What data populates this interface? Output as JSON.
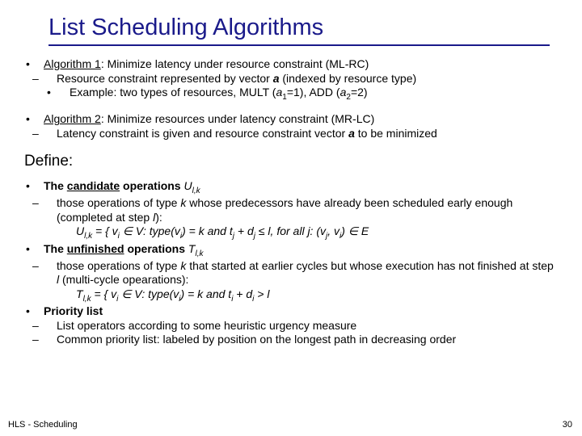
{
  "title": "List Scheduling Algorithms",
  "algo1": {
    "label": "Algorithm 1",
    "desc": ": Minimize latency under resource constraint  (ML-RC)",
    "sub1a": "Resource constraint represented by vector ",
    "sub1b": " (indexed by resource type)",
    "ex_a": "Example: two types of resources, MULT (",
    "ex_b": "=1), ADD (",
    "ex_c": "=2)"
  },
  "algo2": {
    "label": "Algorithm 2",
    "desc": ": Minimize resources under latency constraint  (MR-LC)",
    "sub1a": "Latency constraint is given and resource constraint vector ",
    "sub1b": " to be minimized"
  },
  "define": "Define:",
  "cand": {
    "a": "The ",
    "b": "candidate",
    "c": " operations ",
    "sym": "U",
    "sub": "l,k",
    "s1": "those operations of type ",
    "s1k": "k",
    "s1b": " whose predecessors have already been scheduled early enough (completed at step ",
    "s1l": "l",
    "s1c": "):",
    "f_pre": "U",
    "f1": " = { v",
    "f2": " ∈ V: type(v",
    "f3": ") = k   and   t",
    "f4": " + d",
    "f5": " ≤ l, for all j: (v",
    "f6": ", v",
    "f7": ") ∈ E"
  },
  "unf": {
    "a": "The ",
    "b": "unfinished",
    "c": " operations ",
    "sym": "T",
    "sub": "l,k",
    "s1a": "those operations of type ",
    "s1b": " that started at earlier cycles but whose execution has not finished at step ",
    "s1c": " (multi-cycle opearations):",
    "f1": " = { v",
    "f2": " ∈ V: type(v",
    "f3": ") = k   and   t",
    "f4": " + d",
    "f5": " > l"
  },
  "prio": {
    "h": "Priority list",
    "s1": "List operators according to some heuristic urgency measure",
    "s2": "Common priority list: labeled by position on the longest path in decreasing order"
  },
  "footer_l": "HLS - Scheduling",
  "footer_r": "30",
  "dash": "–",
  "bullet": "•",
  "a": "a",
  "a1": "a",
  "a1s": "1",
  "a2": "a",
  "a2s": "2",
  "i": "i",
  "j": "j",
  "k": "k",
  "l": "l"
}
